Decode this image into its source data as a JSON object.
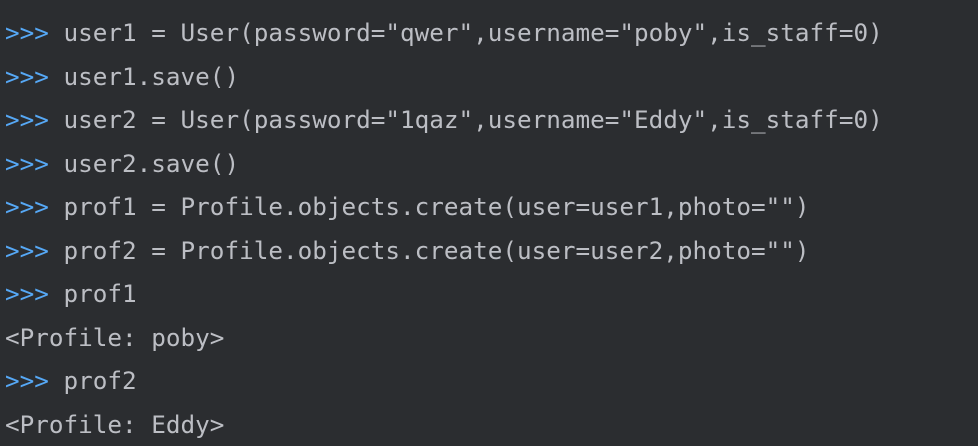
{
  "console": {
    "prompt_symbol": ">>>",
    "lines": [
      {
        "type": "input",
        "text": "user1 = User(password=\"qwer\",username=\"poby\",is_staff=0)"
      },
      {
        "type": "input",
        "text": "user1.save()"
      },
      {
        "type": "input",
        "text": "user2 = User(password=\"1qaz\",username=\"Eddy\",is_staff=0)"
      },
      {
        "type": "input",
        "text": "user2.save()"
      },
      {
        "type": "input",
        "text": "prof1 = Profile.objects.create(user=user1,photo=\"\")"
      },
      {
        "type": "input",
        "text": "prof2 = Profile.objects.create(user=user2,photo=\"\")"
      },
      {
        "type": "input",
        "text": "prof1"
      },
      {
        "type": "output",
        "text": "<Profile: poby>"
      },
      {
        "type": "input",
        "text": "prof2"
      },
      {
        "type": "output",
        "text": "<Profile: Eddy>"
      }
    ]
  },
  "colors": {
    "background": "#2b2d30",
    "prompt": "#56a8f5",
    "text": "#bcbec4"
  }
}
